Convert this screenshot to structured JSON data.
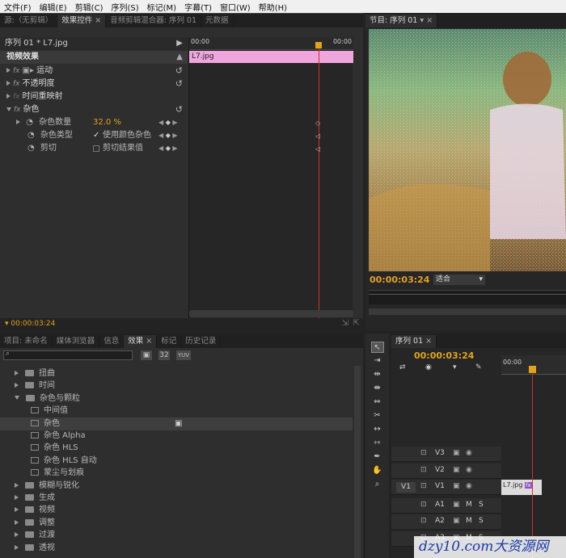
{
  "menu": [
    "文件(F)",
    "编辑(E)",
    "剪辑(C)",
    "序列(S)",
    "标记(M)",
    "字幕(T)",
    "窗口(W)",
    "帮助(H)"
  ],
  "source_tabs": {
    "source": "源:（无剪辑）",
    "effect_controls": "效果控件",
    "close": "×",
    "mixer": "音频剪辑混合器: 序列 01",
    "metadata": "元数据"
  },
  "effect_controls": {
    "seq_clip": "序列 01 * L7.jpg",
    "ruler_start": "00:00",
    "ruler_end": "00:00",
    "clip_label": "L7.jpg",
    "video_effects": "视频效果",
    "motion": "运动",
    "opacity": "不透明度",
    "time_remap": "时间重映射",
    "noise": "杂色",
    "amount_label": "杂色数量",
    "amount_value": "32.0 %",
    "noise_type": "杂色类型",
    "use_color": "使用颜色杂色",
    "clipping": "剪切",
    "clip_result": "剪切结果值",
    "fx": "fx",
    "reset": "↺",
    "kf_prev": "◀",
    "kf_add": "◆",
    "kf_next": "▶",
    "timecode": "00:00:03:24"
  },
  "program": {
    "tab": "节目: 序列 01",
    "timecode": "00:00:03:24",
    "fit": "适合"
  },
  "project_tabs": {
    "project": "项目: 未命名",
    "media": "媒体浏览器",
    "info": "信息",
    "effects": "效果",
    "markers": "标记",
    "history": "历史记录"
  },
  "effects_list": [
    {
      "label": "扭曲",
      "level": 0,
      "type": "folder"
    },
    {
      "label": "时间",
      "level": 0,
      "type": "folder"
    },
    {
      "label": "杂色与颗粒",
      "level": 0,
      "type": "folder",
      "open": true
    },
    {
      "label": "中间值",
      "level": 1,
      "type": "fx"
    },
    {
      "label": "杂色",
      "level": 1,
      "type": "fx",
      "selected": true
    },
    {
      "label": "杂色 Alpha",
      "level": 1,
      "type": "fx"
    },
    {
      "label": "杂色 HLS",
      "level": 1,
      "type": "fx"
    },
    {
      "label": "杂色 HLS 自动",
      "level": 1,
      "type": "fx"
    },
    {
      "label": "蒙尘与划痕",
      "level": 1,
      "type": "fx"
    },
    {
      "label": "模糊与锐化",
      "level": 0,
      "type": "folder"
    },
    {
      "label": "生成",
      "level": 0,
      "type": "folder"
    },
    {
      "label": "视频",
      "level": 0,
      "type": "folder"
    },
    {
      "label": "调整",
      "level": 0,
      "type": "folder"
    },
    {
      "label": "过渡",
      "level": 0,
      "type": "folder"
    },
    {
      "label": "透视",
      "level": 0,
      "type": "folder"
    }
  ],
  "effects_badges": {
    "accel": "▣",
    "b32": "32",
    "yuv": "YUV"
  },
  "timeline": {
    "tab": "序列 01",
    "timecode": "00:00:03:24",
    "ruler": "00:00",
    "tracks": [
      {
        "name": "V3"
      },
      {
        "name": "V2"
      },
      {
        "name": "V1",
        "source": "V1",
        "clip": "L7.jpg",
        "fx": "fx"
      },
      {
        "name": "A1"
      },
      {
        "name": "A2"
      },
      {
        "name": "A3"
      }
    ],
    "m": "M",
    "s": "S"
  },
  "watermark": "dzy10.com大资源网"
}
